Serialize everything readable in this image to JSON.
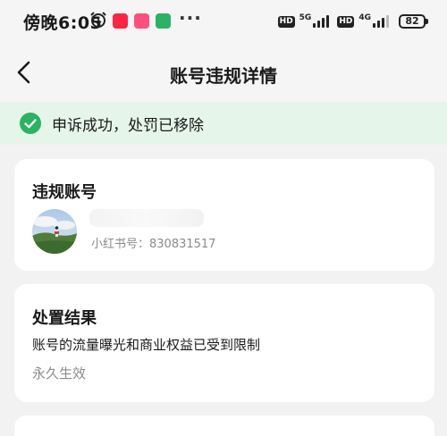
{
  "status_bar": {
    "time": "傍晚6:05",
    "more": "···",
    "sim1": {
      "hd": "HD",
      "network": "5G"
    },
    "sim2": {
      "hd": "HD",
      "network": "4G"
    },
    "battery": "82"
  },
  "header": {
    "title": "账号违规详情"
  },
  "banner": {
    "text": "申诉成功，处罚已移除",
    "color": "#29b45f"
  },
  "account_card": {
    "title": "违规账号",
    "account_id": "小红书号：830831517"
  },
  "result_card": {
    "title": "处置结果",
    "description": "账号的流量曝光和商业权益已受到限制",
    "status": "永久生效"
  },
  "icons": {
    "back": "chevron-left-icon",
    "alarm": "alarm-clock-icon",
    "check": "check-circle-icon"
  }
}
